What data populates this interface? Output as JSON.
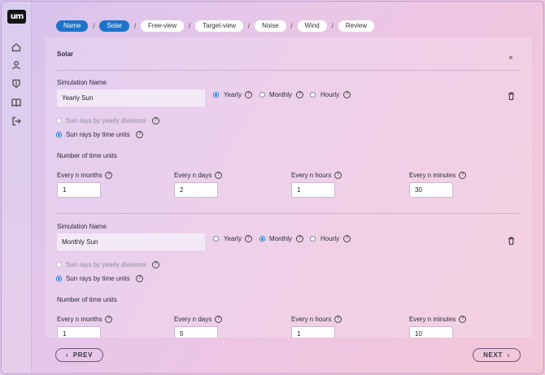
{
  "app": {
    "logo_text": "um"
  },
  "sidebar": {
    "icons": [
      "home-icon",
      "user-icon",
      "shield-icon",
      "book-icon",
      "logout-icon"
    ]
  },
  "breadcrumb": {
    "steps": [
      "Name",
      "Solar",
      "Free-view",
      "Target-view",
      "Noise",
      "Wind",
      "Review"
    ],
    "separator": "/"
  },
  "panel": {
    "title": "Solar",
    "close_glyph": "×"
  },
  "simulations": [
    {
      "name_label": "Simulation Name",
      "name_value": "Yearly Sun",
      "frequency_options": [
        "Yearly",
        "Monthly",
        "Hourly"
      ],
      "frequency_selected": "Yearly",
      "mode_options": [
        "Sun rays by yearly divisions",
        "Sun rays by time units"
      ],
      "mode_selected": "Sun rays by time units",
      "time_units_heading": "Number of time units",
      "fields": [
        {
          "label": "Every n months",
          "value": "1"
        },
        {
          "label": "Every n days",
          "value": "2"
        },
        {
          "label": "Every n hours",
          "value": "1"
        },
        {
          "label": "Every n minutes",
          "value": "30"
        }
      ]
    },
    {
      "name_label": "Simulation Name",
      "name_value": "Monthly Sun",
      "frequency_options": [
        "Yearly",
        "Monthly",
        "Hourly"
      ],
      "frequency_selected": "Monthly",
      "mode_options": [
        "Sun rays by yearly divisions",
        "Sun rays by time units"
      ],
      "mode_selected": "Sun rays by time units",
      "time_units_heading": "Number of time units",
      "fields": [
        {
          "label": "Every n months",
          "value": "1"
        },
        {
          "label": "Every n days",
          "value": "5"
        },
        {
          "label": "Every n hours",
          "value": "1"
        },
        {
          "label": "Every n minutes",
          "value": "10"
        }
      ]
    }
  ],
  "footer": {
    "prev_label": "PREV",
    "next_label": "NEXT"
  },
  "colors": {
    "accent": "#1e73c8"
  }
}
